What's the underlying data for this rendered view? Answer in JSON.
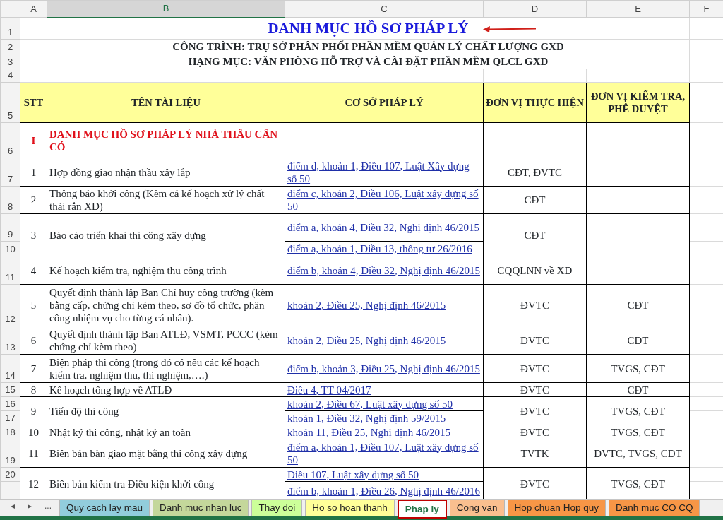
{
  "columns": [
    {
      "label": "A",
      "selected": false
    },
    {
      "label": "B",
      "selected": true
    },
    {
      "label": "C",
      "selected": false
    },
    {
      "label": "D",
      "selected": false
    },
    {
      "label": "E",
      "selected": false
    },
    {
      "label": "F",
      "selected": false
    }
  ],
  "row_numbers": [
    "1",
    "2",
    "3",
    "4",
    "5",
    "6",
    "7",
    "8",
    "9",
    "10",
    "11",
    "12",
    "13",
    "14",
    "15",
    "16",
    "17",
    "18",
    "19",
    "20"
  ],
  "titles": [
    {
      "kind": "main",
      "text": "DANH MỤC HỒ SƠ PHÁP LÝ"
    },
    {
      "kind": "sub",
      "text": "CÔNG TRÌNH: TRỤ SỞ PHÂN PHỐI PHẦN MỀM QUẢN LÝ CHẤT LƯỢNG GXD"
    },
    {
      "kind": "sub",
      "text": "HẠNG MỤC: VĂN PHÒNG HỖ TRỢ VÀ CÀI ĐẶT PHẦN MỀM QLCL GXD"
    }
  ],
  "header": [
    "STT",
    "TÊN TÀI LIỆU",
    "CƠ SỞ PHÁP LÝ",
    "ĐƠN VỊ THỰC HIỆN",
    "ĐƠN VỊ KIỂM TRA,  PHÊ DUYỆT"
  ],
  "section": {
    "stt": "I",
    "name": "DANH MỤC HỒ SƠ PHÁP LÝ NHÀ THẦU CẦN CÓ"
  },
  "items": [
    {
      "stt": "1",
      "name": "Hợp đồng giao nhận thầu xây lắp",
      "basis": [
        "điểm d, khoản 1, Điều 107, Luật Xây dựng số 50"
      ],
      "executor": "CĐT, ĐVTC"
    },
    {
      "stt": "2",
      "name": "Thông báo khởi công (Kèm cả kế hoạch xử lý chất thải rắn XD)",
      "basis": [
        "điểm c, khoản 2, Điều 106, Luật xây dựng số 50"
      ],
      "executor": "CĐT"
    },
    {
      "stt": "3",
      "name": "Báo cáo triển khai thi công xây dựng",
      "basis": [
        "điểm a, khoản 4, Điều 32, Nghị định 46/2015",
        "điểm a, khoản 1, Điều 13, thông tư 26/2016"
      ],
      "executor": "CĐT"
    },
    {
      "stt": "4",
      "name": "Kế hoạch kiểm tra, nghiệm thu công trình",
      "basis": [
        "điểm b, khoản 4, Điều 32, Nghị định 46/2015"
      ],
      "executor": "CQQLNN về XD"
    },
    {
      "stt": "5",
      "name": "Quyết định thành lập Ban Chỉ huy công trường (kèm bằng cấp, chứng chỉ kèm theo, sơ đồ tổ chức, phân công nhiệm vụ cho từng cá nhân).",
      "basis": [
        "khoản 2, Điều 25, Nghị định 46/2015"
      ],
      "executor": "ĐVTC",
      "approver": "CĐT"
    },
    {
      "stt": "6",
      "name": "Quyết định thành lập Ban ATLĐ, VSMT, PCCC (kèm chứng chỉ kèm theo)",
      "basis": [
        "khoản 2, Điều 25, Nghị định 46/2015"
      ],
      "executor": "ĐVTC",
      "approver": "CĐT"
    },
    {
      "stt": "7",
      "name": "Biện pháp thi công (trong đó có nêu các kế hoạch kiểm tra, nghiệm thu, thí nghiệm,….)",
      "basis": [
        "điểm b, khoản 3, Điều 25, Nghị định 46/2015"
      ],
      "executor": "ĐVTC",
      "approver": "TVGS, CĐT"
    },
    {
      "stt": "8",
      "name": "Kế hoạch tổng hợp về ATLĐ",
      "basis": [
        "Điều 4, TT 04/2017"
      ],
      "executor": "ĐVTC",
      "approver": "CĐT"
    },
    {
      "stt": "9",
      "name": "Tiến độ thi công",
      "basis": [
        "khoản 2, Điều 67, Luật xây dựng số 50",
        "khoản 1, Điều 32, Nghị định 59/2015"
      ],
      "executor": "ĐVTC",
      "approver": "TVGS, CĐT"
    },
    {
      "stt": "10",
      "name": "Nhật ký thi công, nhật ký an toàn",
      "basis": [
        "khoản 11, Điều 25, Nghị định 46/2015"
      ],
      "executor": "ĐVTC",
      "approver": "TVGS, CĐT"
    },
    {
      "stt": "11",
      "name": "Biên bản bàn giao mặt bằng thi công xây dựng",
      "basis": [
        "điểm a, khoản 1, Điều 107, Luật xây dựng số 50"
      ],
      "executor": "TVTK",
      "approver": "ĐVTC, TVGS, CĐT"
    },
    {
      "stt": "12",
      "name": "Biên bản kiểm tra Điều kiện khởi công",
      "basis": [
        "Điều 107, Luật xây dựng số 50",
        "điểm b, khoản 1, Điều 26, Nghị định 46/2016"
      ],
      "executor": "ĐVTC",
      "approver": "TVGS, CĐT"
    }
  ],
  "sheet_nav": [
    "◂",
    "▸",
    "..."
  ],
  "tabs": [
    {
      "label": "Quy cach lay mau",
      "color": "#92cddc",
      "selected": false
    },
    {
      "label": "Danh muc nhan luc",
      "color": "#c4d79b",
      "selected": false
    },
    {
      "label": "Thay doi",
      "color": "#ccff99",
      "selected": false
    },
    {
      "label": "Ho so hoan thanh",
      "color": "#ffff99",
      "selected": false
    },
    {
      "label": "Phap ly",
      "selected": true
    },
    {
      "label": "Cong van",
      "color": "#fabf8f",
      "selected": false
    },
    {
      "label": "Hop chuan Hop quy",
      "color": "#f79646",
      "selected": false
    },
    {
      "label": "Danh muc CO CQ",
      "color": "#f79646",
      "selected": false
    }
  ]
}
